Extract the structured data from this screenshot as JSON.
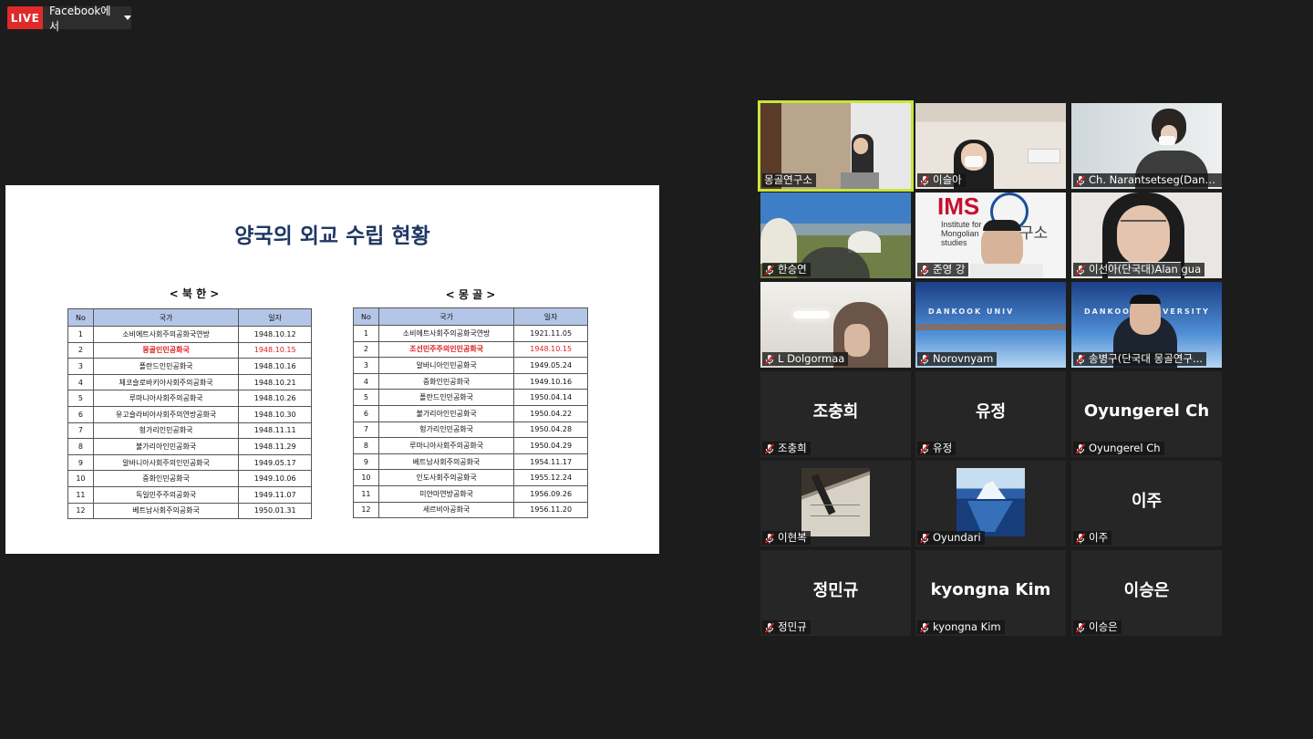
{
  "live": {
    "badge": "LIVE",
    "destination": "Facebook에서"
  },
  "slide": {
    "title": "양국의 외교 수립 현황",
    "left_subtitle": "< 북 한 >",
    "right_subtitle": "< 몽 골 >",
    "headers": {
      "no": "No",
      "country": "국가",
      "date": "일자"
    },
    "north_korea": [
      {
        "no": "1",
        "country": "소비에트사회주의공화국연방",
        "date": "1948.10.12",
        "hl": false
      },
      {
        "no": "2",
        "country": "몽골인민공화국",
        "date": "1948.10.15",
        "hl": true
      },
      {
        "no": "3",
        "country": "폴란드인민공화국",
        "date": "1948.10.16",
        "hl": false
      },
      {
        "no": "4",
        "country": "체코슬로바키아사회주의공화국",
        "date": "1948.10.21",
        "hl": false
      },
      {
        "no": "5",
        "country": "루마니아사회주의공화국",
        "date": "1948.10.26",
        "hl": false
      },
      {
        "no": "6",
        "country": "유고슬라비아사회주의연방공화국",
        "date": "1948.10.30",
        "hl": false
      },
      {
        "no": "7",
        "country": "헝가리인민공화국",
        "date": "1948.11.11",
        "hl": false
      },
      {
        "no": "8",
        "country": "불가리아인민공화국",
        "date": "1948.11.29",
        "hl": false
      },
      {
        "no": "9",
        "country": "알바니아사회주의인민공화국",
        "date": "1949.05.17",
        "hl": false
      },
      {
        "no": "10",
        "country": "중화인민공화국",
        "date": "1949.10.06",
        "hl": false
      },
      {
        "no": "11",
        "country": "독일민주주의공화국",
        "date": "1949.11.07",
        "hl": false
      },
      {
        "no": "12",
        "country": "베트남사회주의공화국",
        "date": "1950.01.31",
        "hl": false
      }
    ],
    "mongolia": [
      {
        "no": "1",
        "country": "소비에트사회주의공화국연방",
        "date": "1921.11.05",
        "hl": false
      },
      {
        "no": "2",
        "country": "조선민주주의인민공화국",
        "date": "1948.10.15",
        "hl": true
      },
      {
        "no": "3",
        "country": "알바니아인민공화국",
        "date": "1949.05.24",
        "hl": false
      },
      {
        "no": "4",
        "country": "중화인민공화국",
        "date": "1949.10.16",
        "hl": false
      },
      {
        "no": "5",
        "country": "폴란드인민공화국",
        "date": "1950.04.14",
        "hl": false
      },
      {
        "no": "6",
        "country": "불가리아인민공화국",
        "date": "1950.04.22",
        "hl": false
      },
      {
        "no": "7",
        "country": "헝가리인민공화국",
        "date": "1950.04.28",
        "hl": false
      },
      {
        "no": "8",
        "country": "루마니아사회주의공화국",
        "date": "1950.04.29",
        "hl": false
      },
      {
        "no": "9",
        "country": "베트남사회주의공화국",
        "date": "1954.11.17",
        "hl": false
      },
      {
        "no": "10",
        "country": "인도사회주의공화국",
        "date": "1955.12.24",
        "hl": false
      },
      {
        "no": "11",
        "country": "미얀마연방공화국",
        "date": "1956.09.26",
        "hl": false
      },
      {
        "no": "12",
        "country": "세르비아공화국",
        "date": "1956.11.20",
        "hl": false
      }
    ]
  },
  "participants": [
    {
      "name": "몽골연구소",
      "type": "video",
      "muted": false,
      "active": true,
      "scene": "podium"
    },
    {
      "name": "이슬아",
      "type": "video",
      "muted": true,
      "scene": "room"
    },
    {
      "name": "Ch. Narantsetseg(Dankoo...",
      "type": "video",
      "muted": true,
      "scene": "office"
    },
    {
      "name": "한승연",
      "type": "video",
      "muted": true,
      "scene": "landscape"
    },
    {
      "name": "준영 강",
      "type": "video",
      "muted": true,
      "scene": "ims",
      "logo_text": "IMS",
      "logo_sub": "Institute for Mongolian studies",
      "logo_kor": "몽골연구소"
    },
    {
      "name": "이선아(단국대)Alan gua",
      "type": "video",
      "muted": true,
      "scene": "face"
    },
    {
      "name": "L Dolgormaa",
      "type": "video",
      "muted": true,
      "scene": "lamp"
    },
    {
      "name": "Norovnyam",
      "type": "video",
      "muted": true,
      "scene": "dankook",
      "banner": "DANKOOK UNIV"
    },
    {
      "name": "송병구(단국대 몽골연구...",
      "type": "video",
      "muted": true,
      "scene": "dankook2",
      "banner": "DANKOOK UNIVERSITY"
    },
    {
      "name": "조충희",
      "type": "text",
      "muted": true,
      "display": "조충희"
    },
    {
      "name": "유정",
      "type": "text",
      "muted": true,
      "display": "유정"
    },
    {
      "name": "Oyungerel Ch",
      "type": "text",
      "muted": true,
      "display": "Oyungerel Ch"
    },
    {
      "name": "이현복",
      "type": "image",
      "muted": true,
      "image": "pen"
    },
    {
      "name": "Oyundari",
      "type": "image",
      "muted": true,
      "image": "iceberg"
    },
    {
      "name": "이주",
      "type": "text",
      "muted": true,
      "display": "이주"
    },
    {
      "name": "정민규",
      "type": "text",
      "muted": true,
      "display": "정민규"
    },
    {
      "name": "kyongna Kim",
      "type": "text",
      "muted": true,
      "display": "kyongna Kim"
    },
    {
      "name": "이승은",
      "type": "text",
      "muted": true,
      "display": "이승은"
    }
  ],
  "colors": {
    "active_outline": "#c8e63c",
    "live_red": "#e02a2a",
    "mute_red": "#e02020",
    "table_header": "#b4c6e7",
    "title_navy": "#1f3864"
  }
}
